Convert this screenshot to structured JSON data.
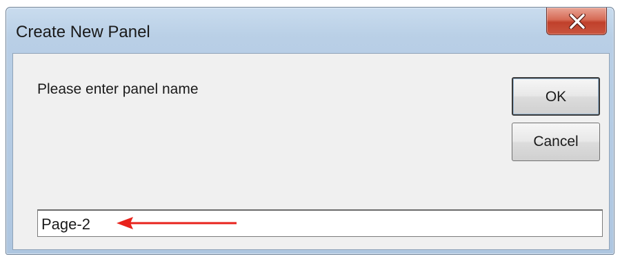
{
  "window": {
    "title": "Create New Panel"
  },
  "dialog": {
    "prompt": "Please enter panel name",
    "ok_label": "OK",
    "cancel_label": "Cancel",
    "name_value": "Page-2"
  },
  "annotation": {
    "arrow_color": "#e8221b"
  },
  "icons": {
    "close": "close-icon"
  },
  "colors": {
    "close_button": "#c9402b",
    "titlebar": "#b9cfe6",
    "client_background": "#f0f0f0"
  }
}
